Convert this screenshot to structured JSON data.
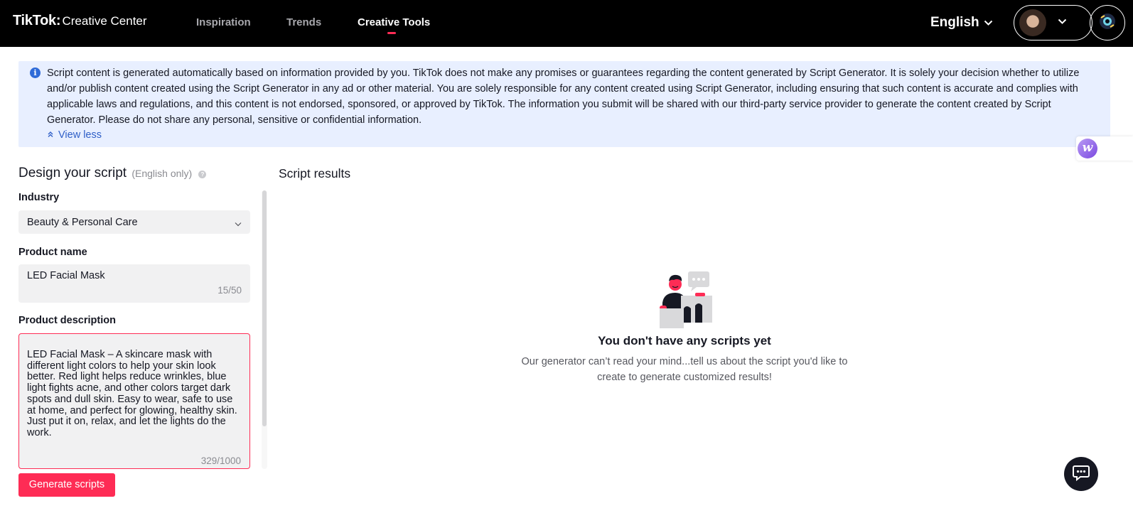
{
  "header": {
    "logo_brand": "TikTok",
    "logo_sub": "Creative Center",
    "nav": [
      {
        "label": "Inspiration"
      },
      {
        "label": "Trends"
      },
      {
        "label": "Creative Tools"
      }
    ],
    "language": "English"
  },
  "banner": {
    "text": "Script content is generated automatically based on information provided by you. TikTok does not make any promises or guarantees regarding the content generated by Script Generator. It is solely your decision whether to utilize and/or publish content created using the Script Generator in any ad or other material. You are solely responsible for any content created using Script Generator, including ensuring that such content is accurate and complies with applicable laws and regulations, and this content is not endorsed, sponsored, or approved by TikTok. The information you submit will be shared with our third-party service provider to generate the content created by Script Generator. Please do not share any personal, sensitive or confidential information.",
    "toggle_label": "View less"
  },
  "design": {
    "title": "Design your script",
    "hint": "(English only)",
    "industry_label": "Industry",
    "industry_value": "Beauty & Personal Care",
    "product_name_label": "Product name",
    "product_name_value": "LED Facial Mask",
    "product_name_counter": "15/50",
    "product_desc_label": "Product description",
    "product_desc_value": "LED Facial Mask – A skincare mask with different light colors to help your skin look better. Red light helps reduce wrinkles, blue light fights acne, and other colors target dark spots and dull skin. Easy to wear, safe to use at home, and perfect for glowing, healthy skin. Just put it on, relax, and let the lights do the work.",
    "product_desc_counter": "329/1000",
    "generate_label": "Generate scripts"
  },
  "results": {
    "title": "Script results",
    "empty_title": "You don't have any scripts yet",
    "empty_desc": "Our generator can’t read your mind...tell us about the script you'd like to create to generate customized results!"
  },
  "colors": {
    "accent": "#fe2c55",
    "banner_bg": "#e8efff",
    "link": "#2f5fc7"
  }
}
